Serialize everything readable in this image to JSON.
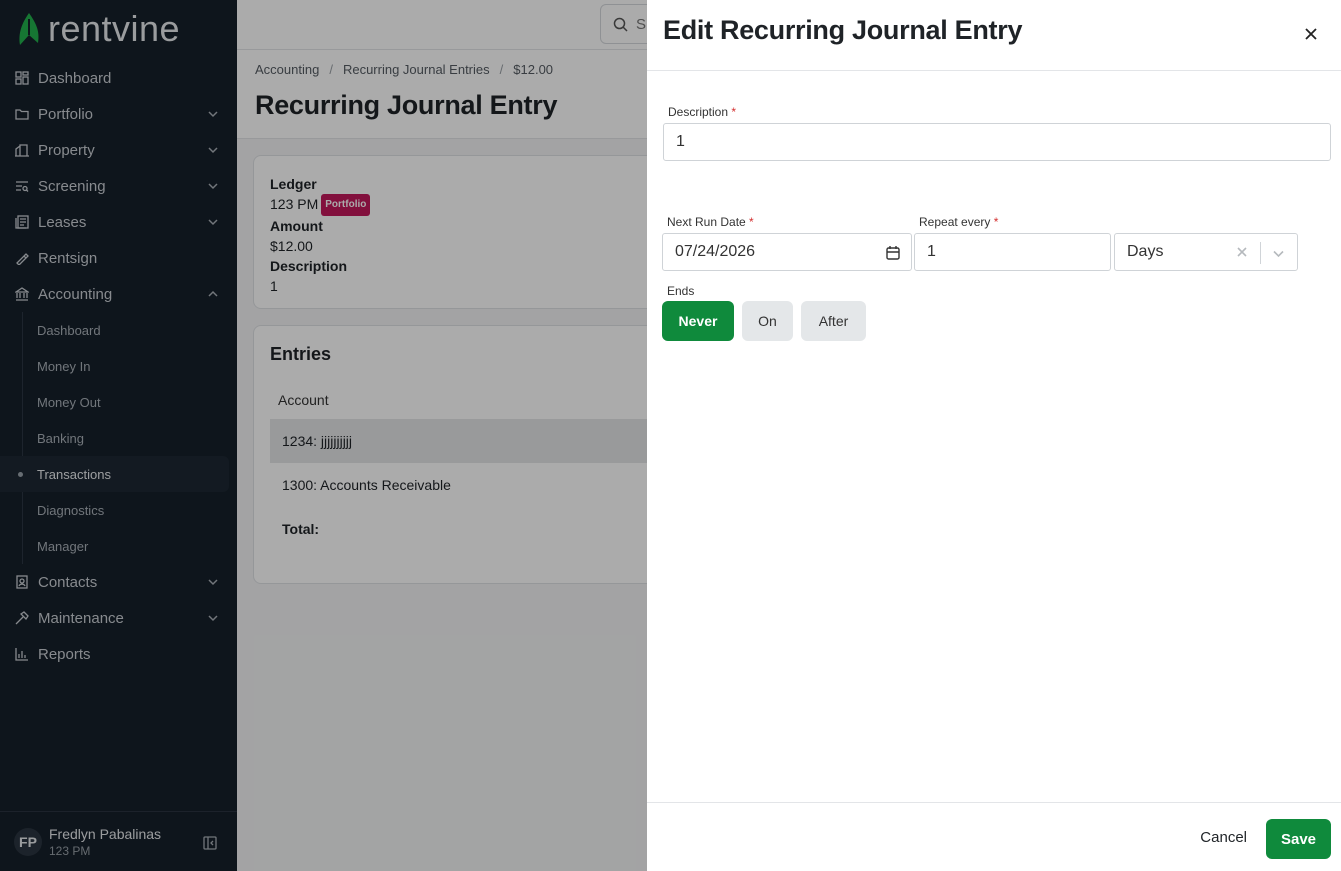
{
  "sidebar": {
    "logo_text": "rentvine",
    "items": [
      {
        "label": "Dashboard"
      },
      {
        "label": "Portfolio"
      },
      {
        "label": "Property"
      },
      {
        "label": "Screening"
      },
      {
        "label": "Leases"
      },
      {
        "label": "Rentsign"
      },
      {
        "label": "Accounting"
      }
    ],
    "accounting_sub": [
      {
        "label": "Dashboard"
      },
      {
        "label": "Money In"
      },
      {
        "label": "Money Out"
      },
      {
        "label": "Banking"
      },
      {
        "label": "Transactions"
      },
      {
        "label": "Diagnostics"
      },
      {
        "label": "Manager"
      }
    ],
    "items_after": [
      {
        "label": "Contacts"
      },
      {
        "label": "Maintenance"
      },
      {
        "label": "Reports"
      }
    ],
    "user": {
      "initials": "FP",
      "name": "Fredlyn Pabalinas",
      "org": "123 PM"
    }
  },
  "topbar": {
    "search_placeholder": "S"
  },
  "breadcrumb": [
    "Accounting",
    "Recurring Journal Entries",
    "$12.00"
  ],
  "page_title": "Recurring Journal Entry",
  "summary": {
    "ledger_label": "Ledger",
    "ledger_value": "123 PM",
    "ledger_badge": "Portfolio",
    "amount_label": "Amount",
    "amount_value": "$12.00",
    "description_label": "Description",
    "description_value": "1"
  },
  "entries": {
    "title": "Entries",
    "column_account": "Account",
    "rows": [
      "1234: jjjjjjjjjj",
      "1300: Accounts Receivable"
    ],
    "total_label": "Total:"
  },
  "drawer": {
    "title": "Edit Recurring Journal Entry",
    "description_label": "Description",
    "description_value": "1",
    "next_run_label": "Next Run Date",
    "next_run_value": "07/24/2026",
    "repeat_label": "Repeat every",
    "repeat_value": "1",
    "repeat_unit": "Days",
    "ends_label": "Ends",
    "ends_options": [
      "Never",
      "On",
      "After"
    ],
    "ends_selected": "Never",
    "cancel_label": "Cancel",
    "save_label": "Save",
    "required_mark": "*"
  },
  "colors": {
    "accent": "#0f8a3c",
    "sidebar_bg": "#16202a",
    "badge": "#c2185b"
  }
}
